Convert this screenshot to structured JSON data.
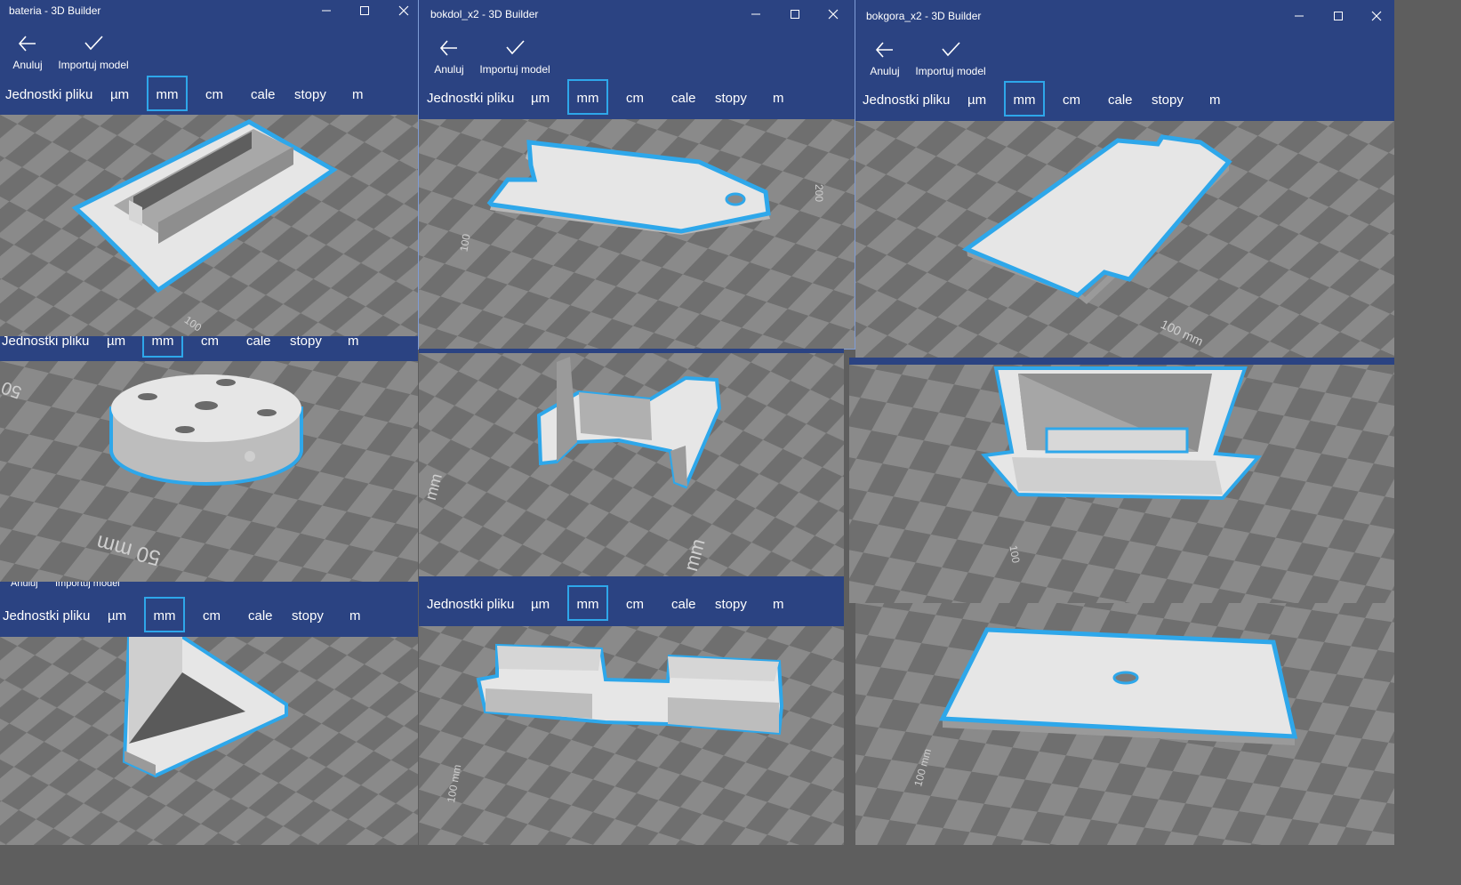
{
  "windows": [
    {
      "title": "bateria - 3D Builder"
    },
    {
      "title": "bokdol_x2 - 3D Builder"
    },
    {
      "title": "bokgora_x2 - 3D Builder"
    }
  ],
  "commands": {
    "cancel": "Anuluj",
    "import": "Importuj model"
  },
  "units": {
    "label": "Jednostki pliku",
    "um": "µm",
    "mm": "mm",
    "cm": "cm",
    "cale": "cale",
    "stopy": "stopy",
    "m": "m",
    "selected": "mm"
  },
  "scale_labels": {
    "l100": "100",
    "l100mm": "100 mm",
    "l50mm": "50 mm",
    "l50": "50",
    "l200": "200",
    "lmm": "mm"
  },
  "colors": {
    "titlebar_bg": "#2b4382",
    "selection_outline": "#2ea7ea",
    "model_fill": "#e6e6e6",
    "floor_light": "#8a8a8a",
    "floor_dark": "#6e6e6e"
  }
}
